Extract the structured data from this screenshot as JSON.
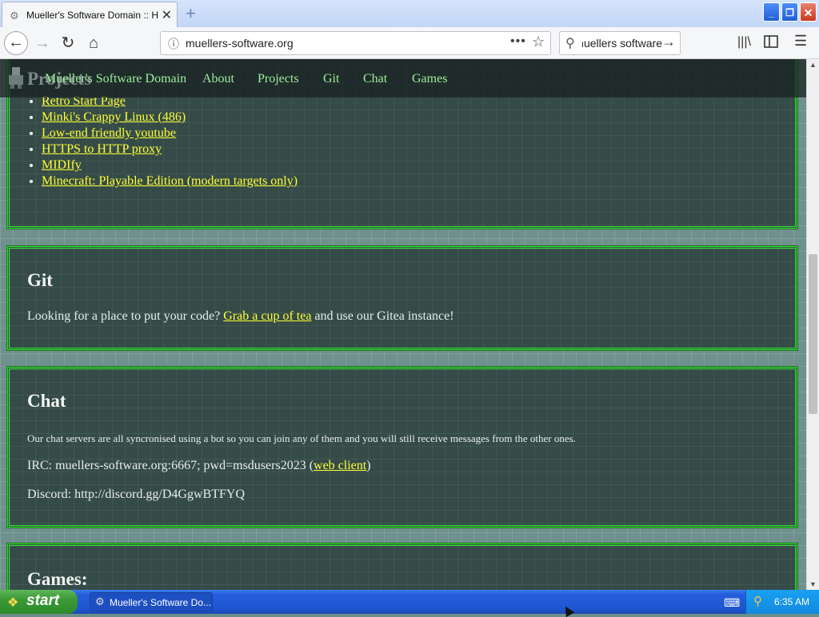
{
  "browser": {
    "tab_title": "Mueller's Software Domain :: Home",
    "url": "muellers-software.org",
    "search_value": "muellers software"
  },
  "site_nav": {
    "ghost_heading": "Projects",
    "links": [
      "Mueller's Software Domain",
      "About",
      "Projects",
      "Git",
      "Chat",
      "Games"
    ]
  },
  "projects": {
    "items": [
      "Retro Start Page",
      "Minki's Crappy Linux (486)",
      "Low-end friendly youtube",
      "HTTPS to HTTP proxy",
      "MIDIfy",
      "Minecraft: Playable Edition (modern targets only)"
    ]
  },
  "git": {
    "heading": "Git",
    "text_before": "Looking for a place to put your code?",
    "link": "Grab a cup of tea",
    "text_after": "and use our Gitea instance!"
  },
  "chat": {
    "heading": "Chat",
    "intro": "Our chat servers are all syncronised using a bot so you can join any of them and you will still receive messages from the other ones.",
    "irc_text": "IRC: muellers-software.org:6667; pwd=msdusers2023 (",
    "irc_link": "web client",
    "irc_close": ")",
    "discord": "Discord: http://discord.gg/D4GgwBTFYQ"
  },
  "games": {
    "heading": "Games:"
  },
  "taskbar": {
    "start_label": "start",
    "task_label": "Mueller's Software Do...",
    "clock": "6:35 AM"
  }
}
